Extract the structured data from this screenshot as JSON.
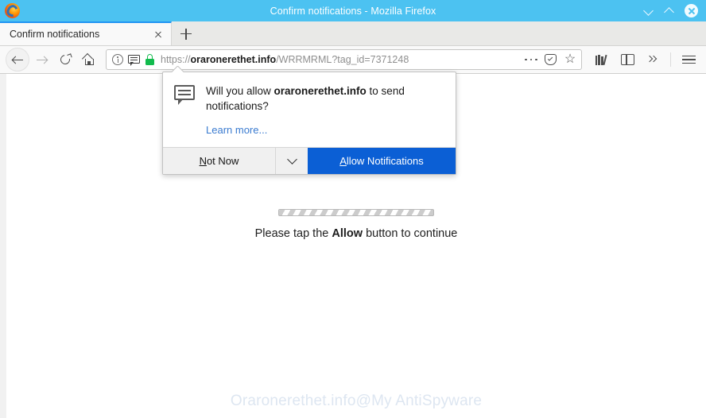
{
  "window": {
    "title": "Confirm notifications - Mozilla Firefox",
    "logo_icon": "firefox-logo",
    "minimize_icon": "chevron-down-icon",
    "maximize_icon": "chevron-up-icon",
    "close_icon": "close-icon"
  },
  "tabs": {
    "active": {
      "label": "Confirm notifications",
      "close_icon": "close-icon"
    },
    "new_tab_icon": "plus-icon"
  },
  "toolbar": {
    "back_icon": "back-arrow-icon",
    "forward_icon": "forward-arrow-icon",
    "reload_icon": "reload-icon",
    "home_icon": "home-icon",
    "library_icon": "library-icon",
    "sidebar_icon": "sidebar-icon",
    "overflow_icon": "double-chevron-icon",
    "menu_icon": "hamburger-menu-icon"
  },
  "urlbar": {
    "info_icon": "info-circle-icon",
    "notification_icon": "speech-bubble-icon",
    "lock_icon": "padlock-icon",
    "scheme": "https://",
    "host": "oraronerethet.info",
    "path": "/WRRMRML?tag_id=7371248",
    "page_actions_icon": "ellipsis-icon",
    "pocket_icon": "shield-check-icon",
    "bookmark_icon": "star-icon",
    "bookmark_glyph": "☆"
  },
  "permission_popup": {
    "icon": "notification-bubble-icon",
    "question_prefix": "Will you allow ",
    "question_host": "oraronerethet.info",
    "question_suffix": " to send notifications?",
    "learn_more": "Learn more...",
    "not_now_accesskey": "N",
    "not_now_rest": "ot Now",
    "dropdown_icon": "chevron-down-icon",
    "allow_accesskey": "A",
    "allow_rest": "llow Notifications",
    "allow_button_color": "#0b5fd5"
  },
  "page": {
    "progress_label": "loading-progress-bar",
    "tap_prefix": "Please tap the ",
    "tap_bold": "Allow",
    "tap_suffix": " button to continue",
    "watermark": "Oraronerethet.info@My AntiSpyware"
  }
}
